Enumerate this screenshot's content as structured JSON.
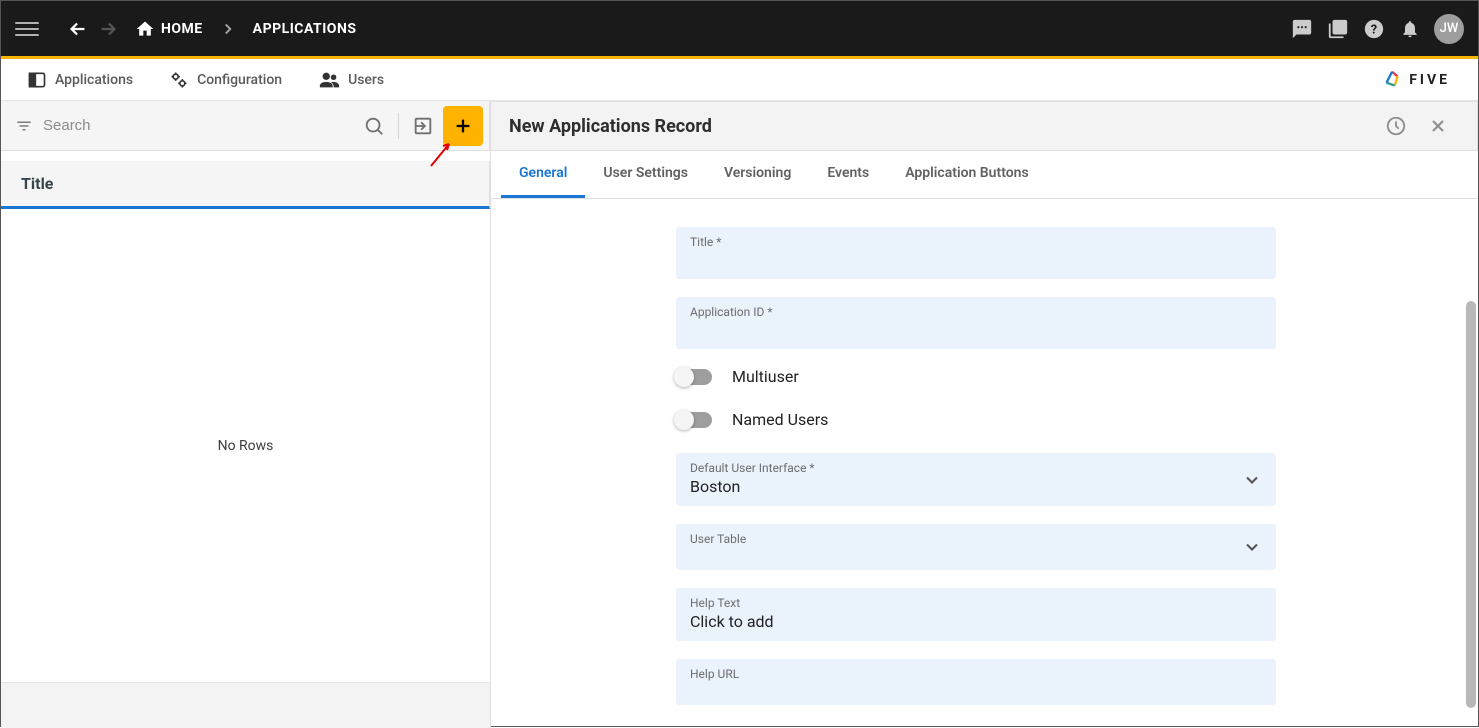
{
  "breadcrumb": {
    "home_label": "HOME",
    "current_label": "APPLICATIONS"
  },
  "avatar_initials": "JW",
  "subnav": {
    "applications": "Applications",
    "configuration": "Configuration",
    "users": "Users",
    "brand": "FIVE"
  },
  "sidebar": {
    "search_placeholder": "Search",
    "column_header": "Title",
    "empty_text": "No Rows"
  },
  "record": {
    "title": "New Applications Record"
  },
  "tabs": {
    "general": "General",
    "user_settings": "User Settings",
    "versioning": "Versioning",
    "events": "Events",
    "app_buttons": "Application Buttons"
  },
  "form": {
    "title_label": "Title *",
    "app_id_label": "Application ID *",
    "multiuser_label": "Multiuser",
    "named_users_label": "Named Users",
    "default_ui_label": "Default User Interface *",
    "default_ui_value": "Boston",
    "user_table_label": "User Table",
    "help_text_label": "Help Text",
    "help_text_value": "Click to add",
    "help_url_label": "Help URL"
  }
}
